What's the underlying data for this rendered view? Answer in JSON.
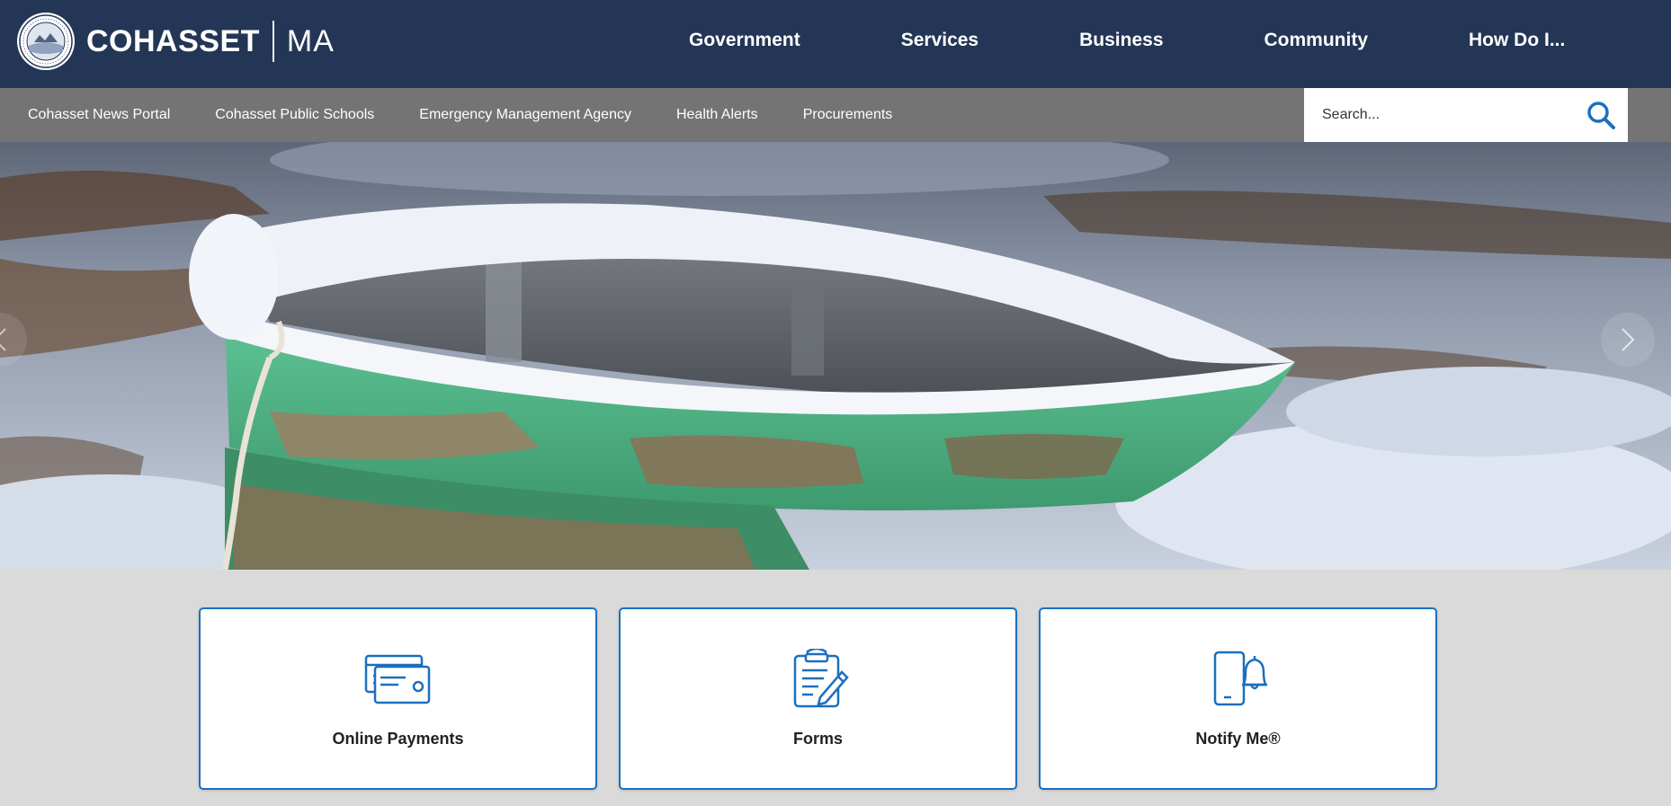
{
  "header": {
    "brand_name": "COHASSET",
    "brand_state": "MA",
    "nav": [
      {
        "label": "Government"
      },
      {
        "label": "Services"
      },
      {
        "label": "Business"
      },
      {
        "label": "Community"
      },
      {
        "label": "How Do I..."
      }
    ],
    "colors": {
      "background": "#243655",
      "text": "#ffffff"
    }
  },
  "subnav": {
    "items": [
      {
        "label": "Cohasset News Portal"
      },
      {
        "label": "Cohasset Public Schools"
      },
      {
        "label": "Emergency Management Agency"
      },
      {
        "label": "Health Alerts"
      },
      {
        "label": "Procurements"
      }
    ],
    "colors": {
      "background": "#747474"
    }
  },
  "search": {
    "placeholder": "Search...",
    "value": "",
    "icon": "search-icon",
    "icon_color": "#1b6fbf"
  },
  "hero": {
    "image": "snow-covered green rowboat",
    "controls": [
      "chevron-left-icon",
      "chevron-right-icon"
    ]
  },
  "quicklinks": [
    {
      "label": "Online Payments",
      "icon": "credit-card-icon"
    },
    {
      "label": "Forms",
      "icon": "clipboard-pen-icon"
    },
    {
      "label": "Notify Me®",
      "icon": "phone-bell-icon"
    }
  ],
  "colors": {
    "accent": "#1b6fbf",
    "page_background": "#dadada"
  }
}
